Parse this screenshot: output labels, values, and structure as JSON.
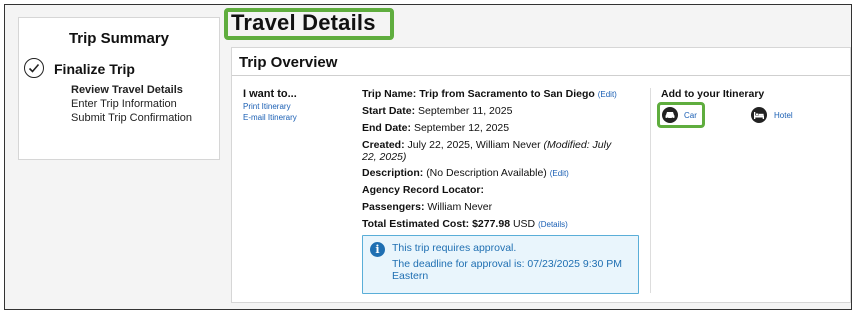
{
  "sidebar": {
    "title": "Trip Summary",
    "step_title": "Finalize Trip",
    "steps": [
      {
        "label": "Review Travel Details",
        "active": true
      },
      {
        "label": "Enter Trip Information",
        "active": false
      },
      {
        "label": "Submit Trip Confirmation",
        "active": false
      }
    ]
  },
  "page": {
    "title": "Travel Details"
  },
  "overview": {
    "title": "Trip Overview",
    "i_want_to": {
      "title": "I want to...",
      "links": [
        "Print Itinerary",
        "E-mail Itinerary"
      ]
    },
    "trip_name_label": "Trip Name:",
    "trip_name": "Trip from Sacramento to San Diego",
    "edit_label": "(Edit)",
    "start_date_label": "Start Date:",
    "start_date": "September 11, 2025",
    "end_date_label": "End Date:",
    "end_date": "September 12, 2025",
    "created_label": "Created:",
    "created": "July 22, 2025, William Never",
    "created_modified": "(Modified: July 22, 2025)",
    "description_label": "Description:",
    "description": "(No Description Available)",
    "agency_label": "Agency Record Locator:",
    "passengers_label": "Passengers:",
    "passengers": "William Never",
    "total_cost_label": "Total Estimated Cost:",
    "total_cost": "$277.98",
    "currency": "USD",
    "details_label": "(Details)",
    "approval": {
      "line1": "This trip requires approval.",
      "line2": "The deadline for approval is: 07/23/2025 9:30 PM Eastern"
    }
  },
  "itinerary": {
    "title": "Add to your Itinerary",
    "items": [
      {
        "label": "Car",
        "icon": "car-icon"
      },
      {
        "label": "Hotel",
        "icon": "bed-icon"
      }
    ]
  },
  "colors": {
    "highlight": "#5fad3e",
    "link": "#1a5fb4",
    "info": "#1f6fb2"
  }
}
